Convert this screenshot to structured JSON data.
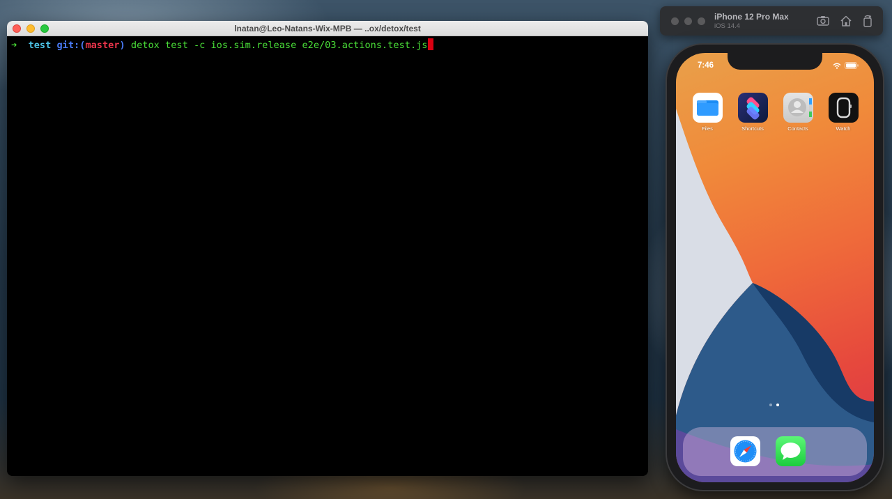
{
  "terminal": {
    "title": "lnatan@Leo-Natans-Wix-MPB — ..ox/detox/test",
    "prompt": {
      "arrow": "➜",
      "cwd": "test",
      "git_label": "git:",
      "paren_open": "(",
      "branch": "master",
      "paren_close": ")",
      "command": "detox test -c ios.sim.release e2e/03.actions.test.js"
    }
  },
  "simulator": {
    "device_name": "iPhone 12 Pro Max",
    "os_version": "iOS 14.4",
    "toolbar_icons": [
      "screenshot-icon",
      "home-icon",
      "rotate-icon"
    ],
    "status_bar": {
      "time": "7:46"
    },
    "apps": [
      {
        "label": "Files",
        "icon": "files-icon"
      },
      {
        "label": "Shortcuts",
        "icon": "shortcuts-icon"
      },
      {
        "label": "Contacts",
        "icon": "contacts-icon"
      },
      {
        "label": "Watch",
        "icon": "watch-icon"
      }
    ],
    "page_count": 2,
    "current_page": 2,
    "dock": [
      {
        "icon": "safari-icon"
      },
      {
        "icon": "messages-icon"
      }
    ]
  },
  "colors": {
    "terminal_bg": "#000000",
    "prompt_arrow": "#4ade38",
    "prompt_cwd": "#4cc2e6",
    "prompt_git": "#4a7bf7",
    "prompt_branch": "#e8344a",
    "command_text": "#4ade38",
    "cursor": "#d90011"
  }
}
